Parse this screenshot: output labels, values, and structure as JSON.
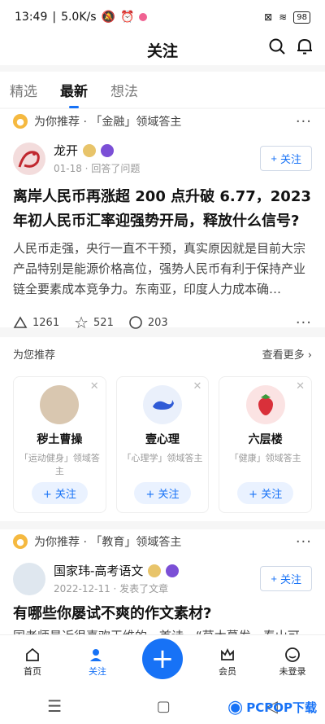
{
  "status": {
    "time": "13:49",
    "speed": "5.0K/s",
    "battery": "98"
  },
  "header": {
    "title": "关注"
  },
  "tabs": [
    {
      "label": "精选"
    },
    {
      "label": "最新"
    },
    {
      "label": "想法"
    }
  ],
  "post1": {
    "recommend": "为你推荐 · 「金融」领域答主",
    "author": "龙开",
    "meta": "01-18 · 回答了问题",
    "follow": "关注",
    "title": "离岸人民币再涨超 200 点升破 6.77，2023 年初人民币汇率迎强势开局，释放什么信号?",
    "excerpt": "人民币走强，央行一直不干预，真实原因就是目前大宗产品特别是能源价格高位，强势人民币有利于保持产业链全要素成本竞争力。东南亚，印度人力成本确…",
    "likes": "1261",
    "stars": "521",
    "comments": "203"
  },
  "recs": {
    "title": "为您推荐",
    "see_all": "查看更多",
    "items": [
      {
        "name": "秽土曹操",
        "desc": "「运动健身」领域答主",
        "follow": "关注"
      },
      {
        "name": "壹心理",
        "desc": "「心理学」领域答主",
        "follow": "关注"
      },
      {
        "name": "六层楼",
        "desc": "「健康」领域答主",
        "follow": "关注"
      }
    ]
  },
  "post2": {
    "recommend": "为你推荐 · 「教育」领域答主",
    "author": "国家玮-高考语文",
    "meta": "2022-12-11 · 发表了文章",
    "follow": "关注",
    "title": "有哪些你屡试不爽的作文素材?",
    "excerpt": "国老师最近很喜欢王维的一首诗，“草木蔓发，春山可"
  },
  "nav": [
    {
      "label": "首页"
    },
    {
      "label": "关注"
    },
    {
      "label": "会员"
    },
    {
      "label": "未登录"
    }
  ],
  "watermark": "PCPOP下载",
  "colors": {
    "accent": "#1772f6"
  }
}
